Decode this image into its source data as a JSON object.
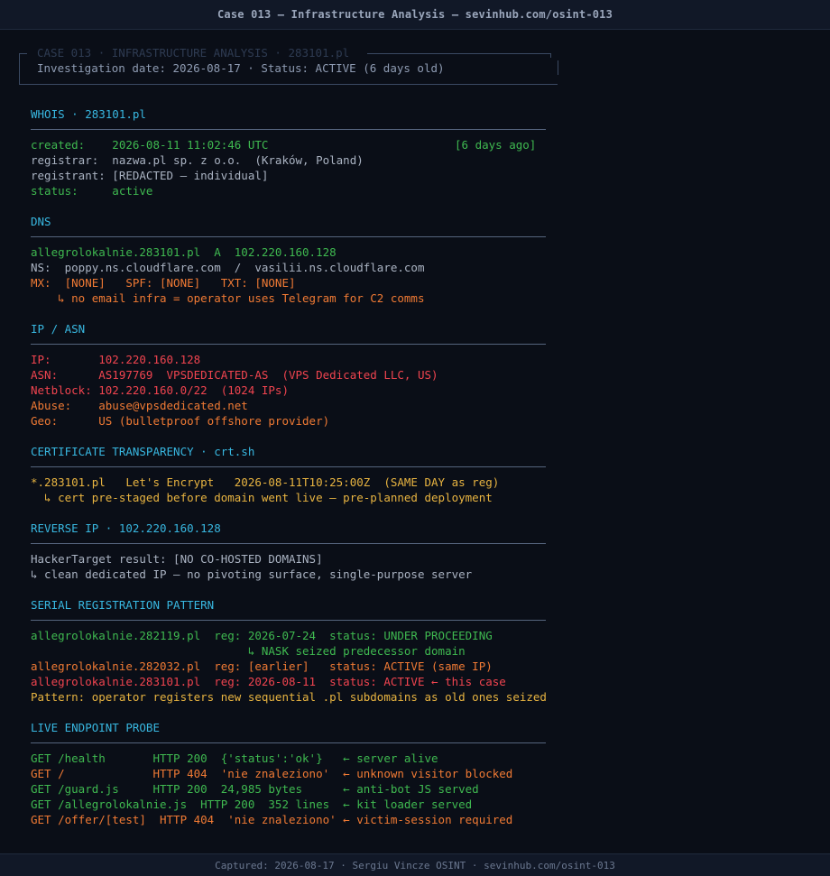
{
  "window": {
    "title": "Case 013 — Infrastructure Analysis  —  sevinhub.com/osint-013"
  },
  "header": {
    "legend": "CASE 013 · INFRASTRUCTURE ANALYSIS · 283101.pl",
    "investigation": "Investigation date: 2026-08-17  ·  Status: ACTIVE (6 days old)"
  },
  "whois": {
    "title": "WHOIS · 283101.pl",
    "created": "created:    2026-08-11 11:02:46 UTC",
    "created_ago": "[6 days ago]",
    "registrar": "registrar:  nazwa.pl sp. z o.o.  (Kraków, Poland)",
    "registrant": "registrant: [REDACTED — individual]",
    "status": "status:     active"
  },
  "dns": {
    "title": "DNS",
    "a_record": "allegrolokalnie.283101.pl  A  102.220.160.128",
    "ns": "NS:  poppy.ns.cloudflare.com  /  vasilii.ns.cloudflare.com",
    "mx": "MX:  [NONE]   SPF: [NONE]   TXT: [NONE]",
    "note": "    ↳ no email infra = operator uses Telegram for C2 comms"
  },
  "ip_asn": {
    "title": "IP / ASN",
    "ip": "IP:       102.220.160.128",
    "asn": "ASN:      AS197769  VPSDEDICATED-AS  (VPS Dedicated LLC, US)",
    "netblock": "Netblock: 102.220.160.0/22  (1024 IPs)",
    "abuse": "Abuse:    abuse@vpsdedicated.net",
    "geo": "Geo:      US (bulletproof offshore provider)"
  },
  "cert": {
    "title": "CERTIFICATE TRANSPARENCY · crt.sh",
    "entry": "*.283101.pl   Let's Encrypt   2026-08-11T10:25:00Z  (SAME DAY as reg)",
    "note": "  ↳ cert pre-staged before domain went live — pre-planned deployment"
  },
  "reverse_ip": {
    "title": "REVERSE IP · 102.220.160.128",
    "result": "HackerTarget result: [NO CO-HOSTED DOMAINS]",
    "note": "↳ clean dedicated IP — no pivoting surface, single-purpose server"
  },
  "serial": {
    "title": "SERIAL REGISTRATION PATTERN",
    "row1": "allegrolokalnie.282119.pl  reg: 2026-07-24  status: UNDER PROCEEDING",
    "row1_note": "                                ↳ NASK seized predecessor domain",
    "row2": "allegrolokalnie.282032.pl  reg: [earlier]   status: ACTIVE (same IP)",
    "row3": "allegrolokalnie.283101.pl  reg: 2026-08-11  status: ACTIVE ← this case",
    "pattern": "Pattern: operator registers new sequential .pl subdomains as old ones seized"
  },
  "probe": {
    "title": "LIVE ENDPOINT PROBE",
    "rows": [
      "GET /health       HTTP 200  {'status':'ok'}   ← server alive",
      "GET /             HTTP 404  'nie znaleziono'  ← unknown visitor blocked",
      "GET /guard.js     HTTP 200  24,985 bytes      ← anti-bot JS served",
      "GET /allegrolokalnie.js  HTTP 200  352 lines  ← kit loader served",
      "GET /offer/[test]  HTTP 404  'nie znaleziono' ← victim-session required"
    ]
  },
  "footer": {
    "text": "Captured: 2026-08-17  ·  Sergiu Vincze OSINT  ·  sevinhub.com/osint-013"
  },
  "colors": {
    "background": "#0a0e17",
    "section": "#38b7e0",
    "green": "#3fb950",
    "red": "#f0444f",
    "orange": "#f07a34",
    "yellow": "#e8b441",
    "text": "#aab3c2"
  }
}
